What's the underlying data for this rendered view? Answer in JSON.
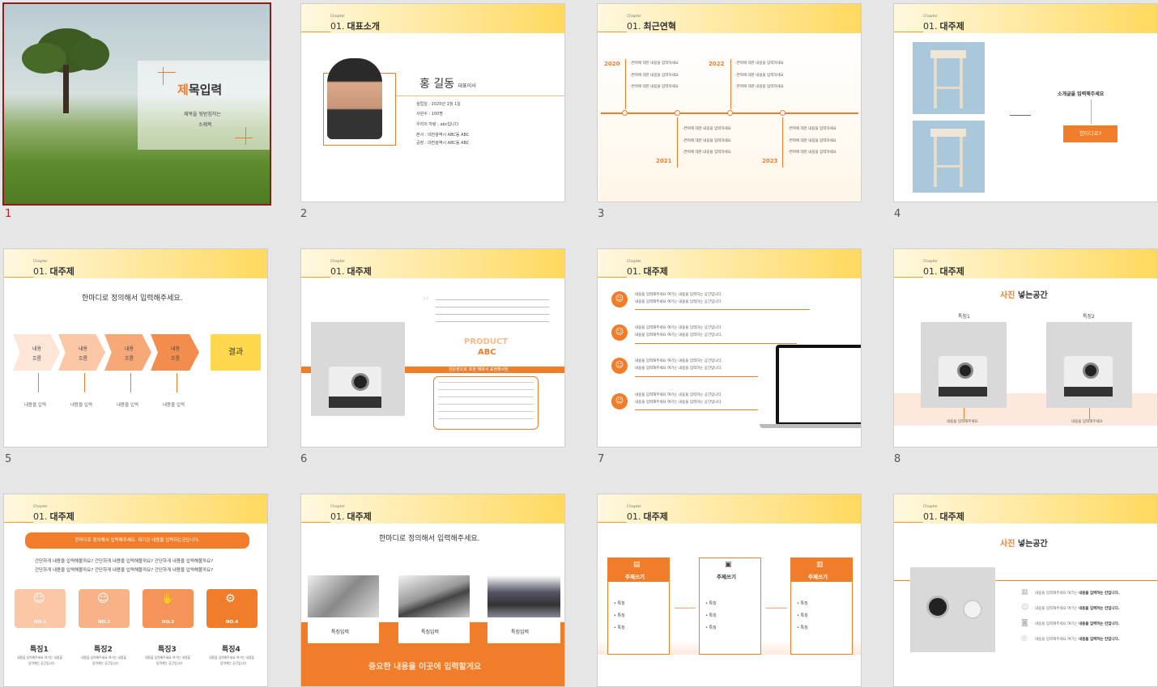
{
  "thumbnails": {
    "s1": {
      "num": "1",
      "title_first": "제",
      "title_rest": "목입력",
      "subtitle1": "제목을 뒷받침하는",
      "subtitle2": "소제목"
    },
    "s2": {
      "num": "2",
      "chapter": "Chapter",
      "no": "01.",
      "title": "대표소개",
      "name": "홍 길동",
      "role": "대표이사",
      "items": [
        "설립일 : 2020년 1월 1일",
        "사원수 : 100명",
        "우리의 자랑 : abc입니다",
        "본사 : 대전광역시 ABC동 ABC",
        "공장 : 대전광역시 ABC동 ABC"
      ]
    },
    "s3": {
      "num": "3",
      "chapter": "Chapter",
      "no": "01.",
      "title": "최근연혁",
      "years": [
        "2020",
        "2021",
        "2022",
        "2023"
      ],
      "item": "-연혁에 대한 내용을 입력하세요"
    },
    "s4": {
      "num": "4",
      "chapter": "Chapter",
      "no": "01.",
      "title": "대주제",
      "intro": "소개글을 입력해주세요",
      "button": "한마디로?"
    },
    "s5": {
      "num": "5",
      "chapter": "Chapter",
      "no": "01.",
      "title": "대주제",
      "heading": "한마디로 정의해서 입력해주세요.",
      "flow_label1": "내용",
      "flow_label2": "흐름",
      "result": "결과",
      "input": "내용을 입력"
    },
    "s6": {
      "num": "6",
      "chapter": "Chapter",
      "no": "01.",
      "title": "대주제",
      "product1": "PRODUCT",
      "product2": "ABC",
      "banner": "한문장으로 포현 해봐서 표현해서한"
    },
    "s7": {
      "num": "7",
      "chapter": "Chapter",
      "no": "01.",
      "title": "대주제",
      "line1": "내용을 입력해주세요 여기는 내용을 입력하는 공간입니다.",
      "line2": "내용을 입력해주세요 여기는 내용을 입력하는 공간입니다."
    },
    "s8": {
      "num": "8",
      "chapter": "Chapter",
      "no": "01.",
      "title": "대주제",
      "heading_a": "사진",
      "heading_b": "넣는공간",
      "feat1": "특징1",
      "feat2": "특징2",
      "caption": "내용을 입력해주세요"
    },
    "s9": {
      "num": "9",
      "chapter": "Chapter",
      "no": "01.",
      "title": "대주제",
      "banner": "한마디로 정의해서 입력해주세요. 여기은 내용을 입력하는곳입니다.",
      "q1": "간단하게 내용을 입력해볼까요? 간단하게 내용을 입력해볼까요? 간단하게 내용을 입력해볼까요?",
      "q2": "간단하게 내용을 입력해볼까요? 간단하게 내용을 입력해볼까요? 간단하게 내용을 입력해볼까요?",
      "nos": [
        "NO.1",
        "NO.2",
        "NO.3",
        "NO.4"
      ],
      "feats": [
        "특징1",
        "특징2",
        "특징3",
        "특징4"
      ],
      "desc1": "내용을 입력해주세요 여기는 내용을",
      "desc2": "입력해는 공간입니다"
    },
    "s10": {
      "num": "10",
      "chapter": "Chapter",
      "no": "01.",
      "title": "대주제",
      "heading": "한마디로 정의해서 입력해주세요.",
      "feat": "특징입력",
      "footer": "중요한 내용을 이곳에 입력할게요"
    },
    "s11": {
      "num": "11",
      "chapter": "Chapter",
      "no": "01.",
      "title": "대주제",
      "col": "주제쓰기",
      "bullet": "특징"
    },
    "s12": {
      "num": "12",
      "chapter": "Chapter",
      "no": "01.",
      "title": "대주제",
      "heading_a": "사진",
      "heading_b": "넣는공간",
      "row_a": "내용을 입력해주세요 여기는",
      "row_b": "내용을 입력하는 칸입니다."
    }
  },
  "colors": {
    "accent": "#f07d2a",
    "accent_light": "#fbb98a",
    "header": "#ffd95e",
    "selected": "#8c1d1d"
  }
}
